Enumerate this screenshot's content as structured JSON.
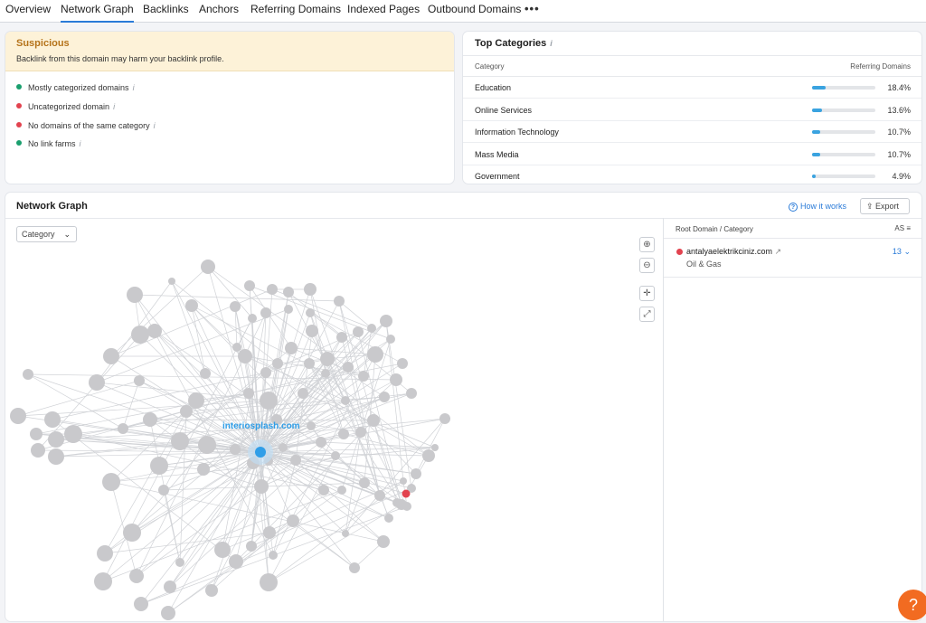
{
  "tabs": [
    {
      "label": "Overview"
    },
    {
      "label": "Network Graph"
    },
    {
      "label": "Backlinks"
    },
    {
      "label": "Anchors"
    },
    {
      "label": "Referring Domains"
    },
    {
      "label": "Indexed Pages"
    },
    {
      "label": "Outbound Domains"
    }
  ],
  "tabs_more": "•••",
  "suspicious": {
    "title": "Suspicious",
    "description": "Backlink from this domain may harm your backlink profile.",
    "items": [
      {
        "label": "Mostly categorized domains",
        "status_color": "#1a9f6e"
      },
      {
        "label": "Uncategorized domain",
        "status_color": "#e2434f"
      },
      {
        "label": "No domains of the same category",
        "status_color": "#e2434f"
      },
      {
        "label": "No link farms",
        "status_color": "#1a9f6e"
      }
    ]
  },
  "top_categories": {
    "title": "Top Categories",
    "col_category": "Category",
    "col_ref": "Referring Domains",
    "rows": [
      {
        "name": "Education",
        "pct": "18.4%",
        "value": 18.4
      },
      {
        "name": "Online Services",
        "pct": "13.6%",
        "value": 13.6
      },
      {
        "name": "Information Technology",
        "pct": "10.7%",
        "value": 10.7
      },
      {
        "name": "Mass Media",
        "pct": "10.7%",
        "value": 10.7
      },
      {
        "name": "Government",
        "pct": "4.9%",
        "value": 4.9
      }
    ]
  },
  "network": {
    "title": "Network Graph",
    "how_it_works": "How it works",
    "export": "Export",
    "category_select": "Category",
    "center_label": "interiosplash.com",
    "colors": {
      "node": "#c9c9cc",
      "center": "#2f9ee8",
      "flagged": "#e2434f",
      "edge": "#d0d2d6"
    }
  },
  "side_panel": {
    "col_root": "Root Domain / Category",
    "col_as": "AS",
    "rows": [
      {
        "domain": "antalyaelektrikciniz.com",
        "category": "Oil & Gas",
        "as": "13"
      }
    ]
  },
  "help": "?"
}
